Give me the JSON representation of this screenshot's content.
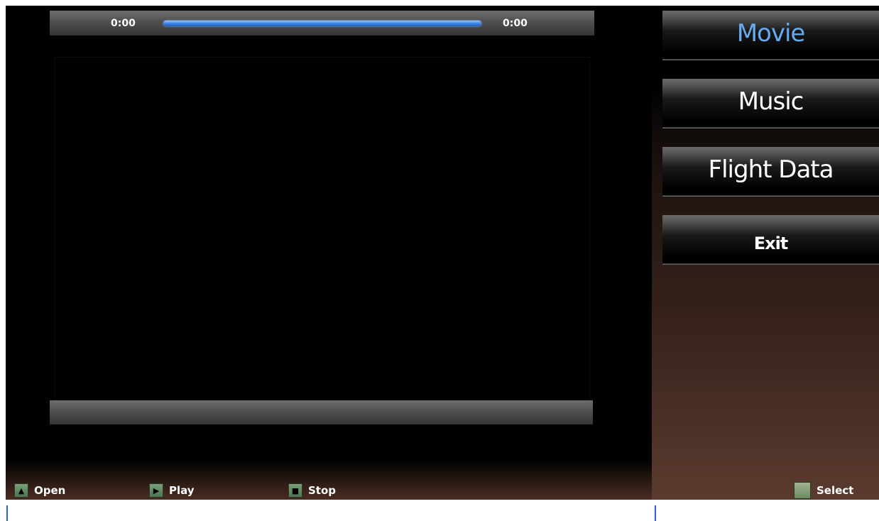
{
  "caption": "",
  "player": {
    "time_elapsed": "0:00",
    "time_total": "0:00",
    "progress": 0
  },
  "menu": {
    "items": [
      {
        "label": "Movie",
        "selected": true
      },
      {
        "label": "Music",
        "selected": false
      },
      {
        "label": "Flight Data",
        "selected": false
      },
      {
        "label": "Exit",
        "selected": false
      }
    ]
  },
  "hints": {
    "open": {
      "label": "Open",
      "icon": "triangle-up-icon"
    },
    "play": {
      "label": "Play",
      "icon": "play-icon"
    },
    "stop": {
      "label": "Stop",
      "icon": "stop-icon"
    },
    "select": {
      "label": "Select",
      "icon": "square-button-icon"
    }
  },
  "colors": {
    "selected_text": "#66aaf0",
    "progress_bar": "#3c86e6",
    "hint_icon": "#6f8f6a",
    "panel_brown": "#5b3b2f"
  }
}
